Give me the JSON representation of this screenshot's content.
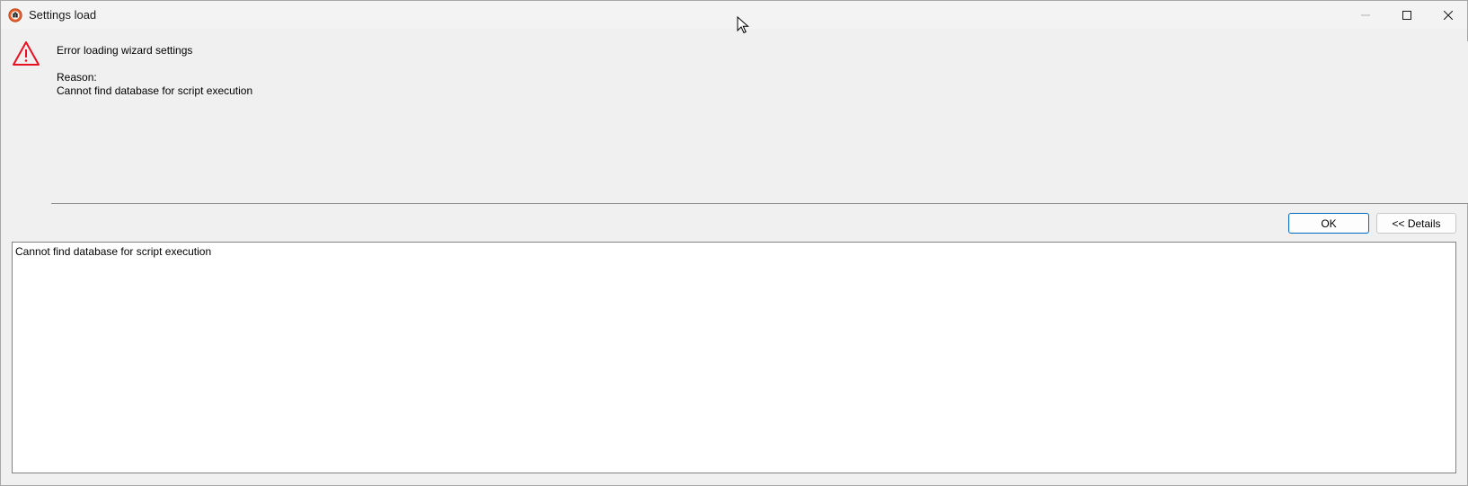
{
  "window": {
    "title": "Settings load",
    "controls": {
      "minimize_icon": "minimize-icon",
      "maximize_icon": "maximize-icon",
      "close_icon": "close-icon"
    }
  },
  "message": {
    "icon": "warning-icon",
    "text": "Error loading wizard settings\n\nReason:\nCannot find database for script execution"
  },
  "buttons": {
    "ok_label": "OK",
    "details_label": "<< Details"
  },
  "details": {
    "text": "Cannot find database for script execution"
  },
  "colors": {
    "accent": "#0067c0",
    "warning": "#e81123"
  }
}
